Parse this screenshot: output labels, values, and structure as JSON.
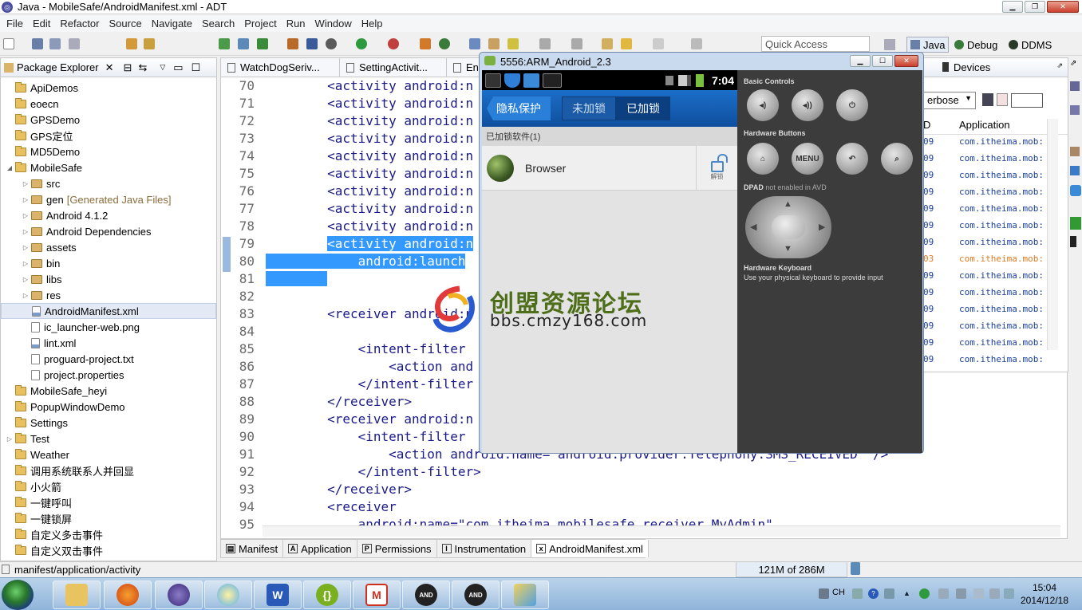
{
  "window": {
    "title": "Java - MobileSafe/AndroidManifest.xml - ADT"
  },
  "menu": [
    "File",
    "Edit",
    "Refactor",
    "Source",
    "Navigate",
    "Search",
    "Project",
    "Run",
    "Window",
    "Help"
  ],
  "quick_access": {
    "placeholder": "Quick Access"
  },
  "perspectives": [
    "Java",
    "Debug",
    "DDMS"
  ],
  "package_explorer": {
    "title": "Package Explorer",
    "items": [
      {
        "label": "ApiDemos",
        "level": 0,
        "type": "proj",
        "twisty": ""
      },
      {
        "label": "eoecn",
        "level": 0,
        "type": "proj",
        "twisty": ""
      },
      {
        "label": "GPSDemo",
        "level": 0,
        "type": "proj",
        "twisty": ""
      },
      {
        "label": "GPS定位",
        "level": 0,
        "type": "proj",
        "twisty": ""
      },
      {
        "label": "MD5Demo",
        "level": 0,
        "type": "proj",
        "twisty": ""
      },
      {
        "label": "MobileSafe",
        "level": 0,
        "type": "proj",
        "twisty": "◢"
      },
      {
        "label": "src",
        "level": 1,
        "type": "pkg",
        "twisty": "▷"
      },
      {
        "label": "gen",
        "extra": "[Generated Java Files]",
        "level": 1,
        "type": "pkg",
        "twisty": "▷"
      },
      {
        "label": "Android 4.1.2",
        "level": 1,
        "type": "pkg",
        "twisty": "▷"
      },
      {
        "label": "Android Dependencies",
        "level": 1,
        "type": "pkg",
        "twisty": "▷"
      },
      {
        "label": "assets",
        "level": 1,
        "type": "pkg",
        "twisty": "▷"
      },
      {
        "label": "bin",
        "level": 1,
        "type": "pkg",
        "twisty": "▷"
      },
      {
        "label": "libs",
        "level": 1,
        "type": "pkg",
        "twisty": "▷"
      },
      {
        "label": "res",
        "level": 1,
        "type": "pkg",
        "twisty": "▷"
      },
      {
        "label": "AndroidManifest.xml",
        "level": 1,
        "type": "xml",
        "twisty": "",
        "selected": true
      },
      {
        "label": "ic_launcher-web.png",
        "level": 1,
        "type": "file",
        "twisty": ""
      },
      {
        "label": "lint.xml",
        "level": 1,
        "type": "xml",
        "twisty": ""
      },
      {
        "label": "proguard-project.txt",
        "level": 1,
        "type": "file",
        "twisty": ""
      },
      {
        "label": "project.properties",
        "level": 1,
        "type": "file",
        "twisty": ""
      },
      {
        "label": "MobileSafe_heyi",
        "level": 0,
        "type": "proj",
        "twisty": ""
      },
      {
        "label": "PopupWindowDemo",
        "level": 0,
        "type": "proj",
        "twisty": ""
      },
      {
        "label": "Settings",
        "level": 0,
        "type": "proj",
        "twisty": ""
      },
      {
        "label": "Test",
        "level": 0,
        "type": "proj",
        "twisty": "▷"
      },
      {
        "label": "Weather",
        "level": 0,
        "type": "proj",
        "twisty": ""
      },
      {
        "label": "调用系统联系人并回显",
        "level": 0,
        "type": "proj",
        "twisty": ""
      },
      {
        "label": "小火箭",
        "level": 0,
        "type": "proj",
        "twisty": ""
      },
      {
        "label": "一键呼叫",
        "level": 0,
        "type": "proj",
        "twisty": ""
      },
      {
        "label": "一键锁屏",
        "level": 0,
        "type": "proj",
        "twisty": ""
      },
      {
        "label": "自定义多击事件",
        "level": 0,
        "type": "proj",
        "twisty": ""
      },
      {
        "label": "自定义双击事件",
        "level": 0,
        "type": "proj",
        "twisty": ""
      }
    ]
  },
  "editor": {
    "tabs": [
      "WatchDogSeriv...",
      "SettingActivit...",
      "En"
    ],
    "line_numbers": [
      "70",
      "71",
      "72",
      "73",
      "74",
      "75",
      "76",
      "77",
      "78",
      "79",
      "80",
      "81",
      "82",
      "83",
      "84",
      "85",
      "86",
      "87",
      "88",
      "89",
      "90",
      "91",
      "92",
      "93",
      "94",
      "95"
    ],
    "lines": [
      "        <activity android:n",
      "        <activity android:n",
      "        <activity android:n",
      "        <activity android:n",
      "        <activity android:n",
      "        <activity android:n",
      "        <activity android:n",
      "        <activity android:n",
      "        <activity android:n",
      "        <activity android:n",
      "            android:launch",
      "",
      "",
      "        <receiver android:n",
      "",
      "            <intent-filter",
      "                <action and",
      "            </intent-filter",
      "        </receiver>",
      "        <receiver android:n",
      "            <intent-filter",
      "                <action android:name=\"android.provider.Telephony.SMS_RECEIVED\" />",
      "            </intent-filter>",
      "        </receiver>",
      "        <receiver",
      "            android:name=\"com.itheima.mobilesafe.receiver.MyAdmin\""
    ],
    "bottom_tabs": [
      "Manifest",
      "Application",
      "Permissions",
      "Instrumentation",
      "AndroidManifest.xml"
    ]
  },
  "devices": {
    "title": "Devices",
    "filter": "erbose",
    "col_id": "D",
    "col_app": "Application",
    "ids": [
      "09",
      "09",
      "09",
      "09",
      "09",
      "09",
      "09",
      "03",
      "09",
      "09",
      "09",
      "09",
      "09",
      "09"
    ],
    "apps": [
      "com.itheima.mob:",
      "com.itheima.mob:",
      "com.itheima.mob:",
      "com.itheima.mob:",
      "com.itheima.mob:",
      "com.itheima.mob:",
      "com.itheima.mob:",
      "com.itheima.mob:",
      "com.itheima.mob:",
      "com.itheima.mob:",
      "com.itheima.mob:",
      "com.itheima.mob:",
      "com.itheima.mob:",
      "com.itheima.mob:"
    ],
    "highlight_row": 7
  },
  "emulator": {
    "title": "5556:ARM_Android_2.3",
    "time": "7:04",
    "back_label": "隐私保护",
    "tabs": [
      "未加锁",
      "已加锁"
    ],
    "active_tab": 1,
    "section": "已加锁软件(1)",
    "app": {
      "name": "Browser",
      "action": "解锁"
    },
    "controls": {
      "basic": "Basic Controls",
      "hardware": "Hardware Buttons",
      "menu": "MENU",
      "dpad": "DPAD",
      "dpad_note": "not enabled in AVD",
      "keyboard": "Hardware Keyboard",
      "keyboard_note": "Use your physical keyboard to provide input"
    }
  },
  "watermark": {
    "line1": "创盟资源论坛",
    "line2": "bbs.cmzy168.com"
  },
  "status": {
    "path": "manifest/application/activity",
    "memory": "121M of 286M"
  },
  "taskbar": {
    "time": "15:04",
    "date": "2014/12/18",
    "lang": "CH"
  }
}
